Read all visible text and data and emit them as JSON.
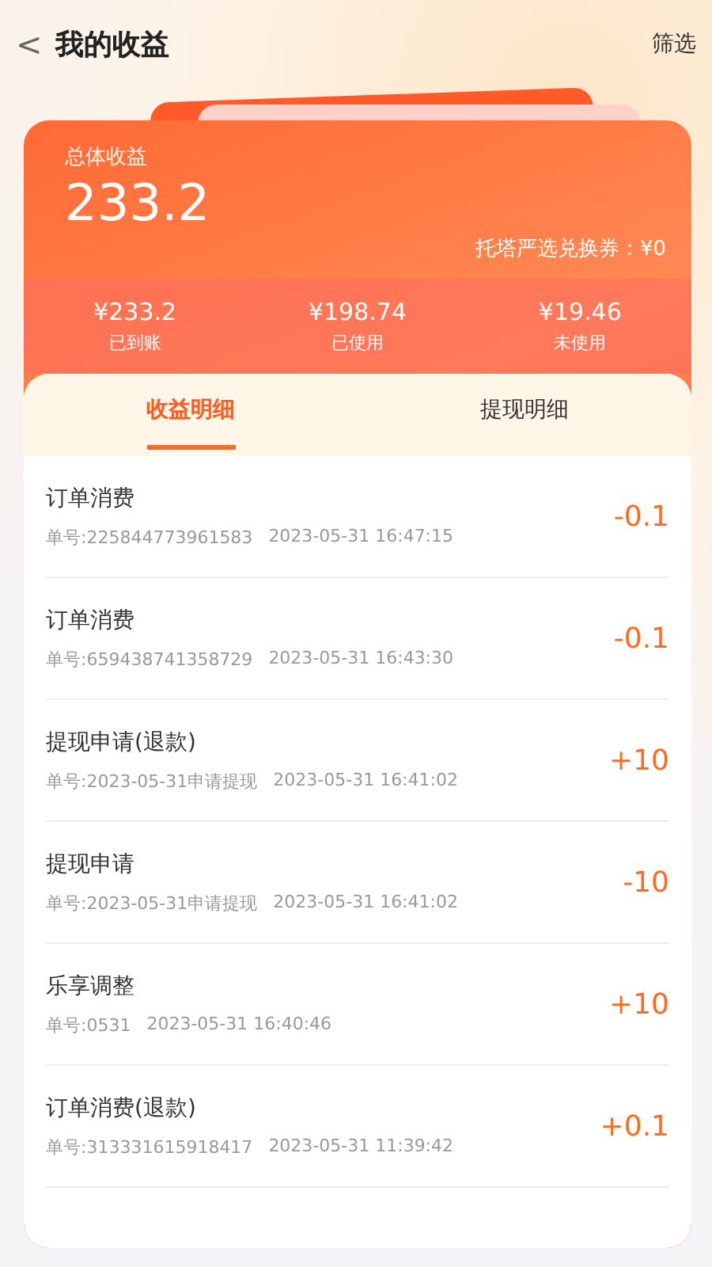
{
  "header": {
    "back": "<",
    "title": "我的收益",
    "action": "筛选"
  },
  "summary": {
    "label": "总体收益",
    "total": "233.2",
    "voucher": "托塔严选兑换券：¥0"
  },
  "stats": [
    {
      "value": "¥233.2",
      "label": "已到账"
    },
    {
      "value": "¥198.74",
      "label": "已使用"
    },
    {
      "value": "¥19.46",
      "label": "未使用"
    }
  ],
  "tabs": [
    {
      "label": "收益明细",
      "selected": true
    },
    {
      "label": "提现明细",
      "selected": false
    }
  ],
  "records": [
    {
      "title": "订单消费",
      "order": "单号:225844773961583",
      "time": "2023-05-31 16:47:15",
      "amount": "-0.1"
    },
    {
      "title": "订单消费",
      "order": "单号:659438741358729",
      "time": "2023-05-31 16:43:30",
      "amount": "-0.1"
    },
    {
      "title": "提现申请(退款)",
      "order": "单号:2023-05-31申请提现",
      "time": "2023-05-31 16:41:02",
      "amount": "+10"
    },
    {
      "title": "提现申请",
      "order": "单号:2023-05-31申请提现",
      "time": "2023-05-31 16:41:02",
      "amount": "-10"
    },
    {
      "title": "乐享调整",
      "order": "单号:0531",
      "time": "2023-05-31 16:40:46",
      "amount": "+10"
    },
    {
      "title": "订单消费(退款)",
      "order": "单号:313331615918417",
      "time": "2023-05-31 11:39:42",
      "amount": "+0.1"
    }
  ]
}
